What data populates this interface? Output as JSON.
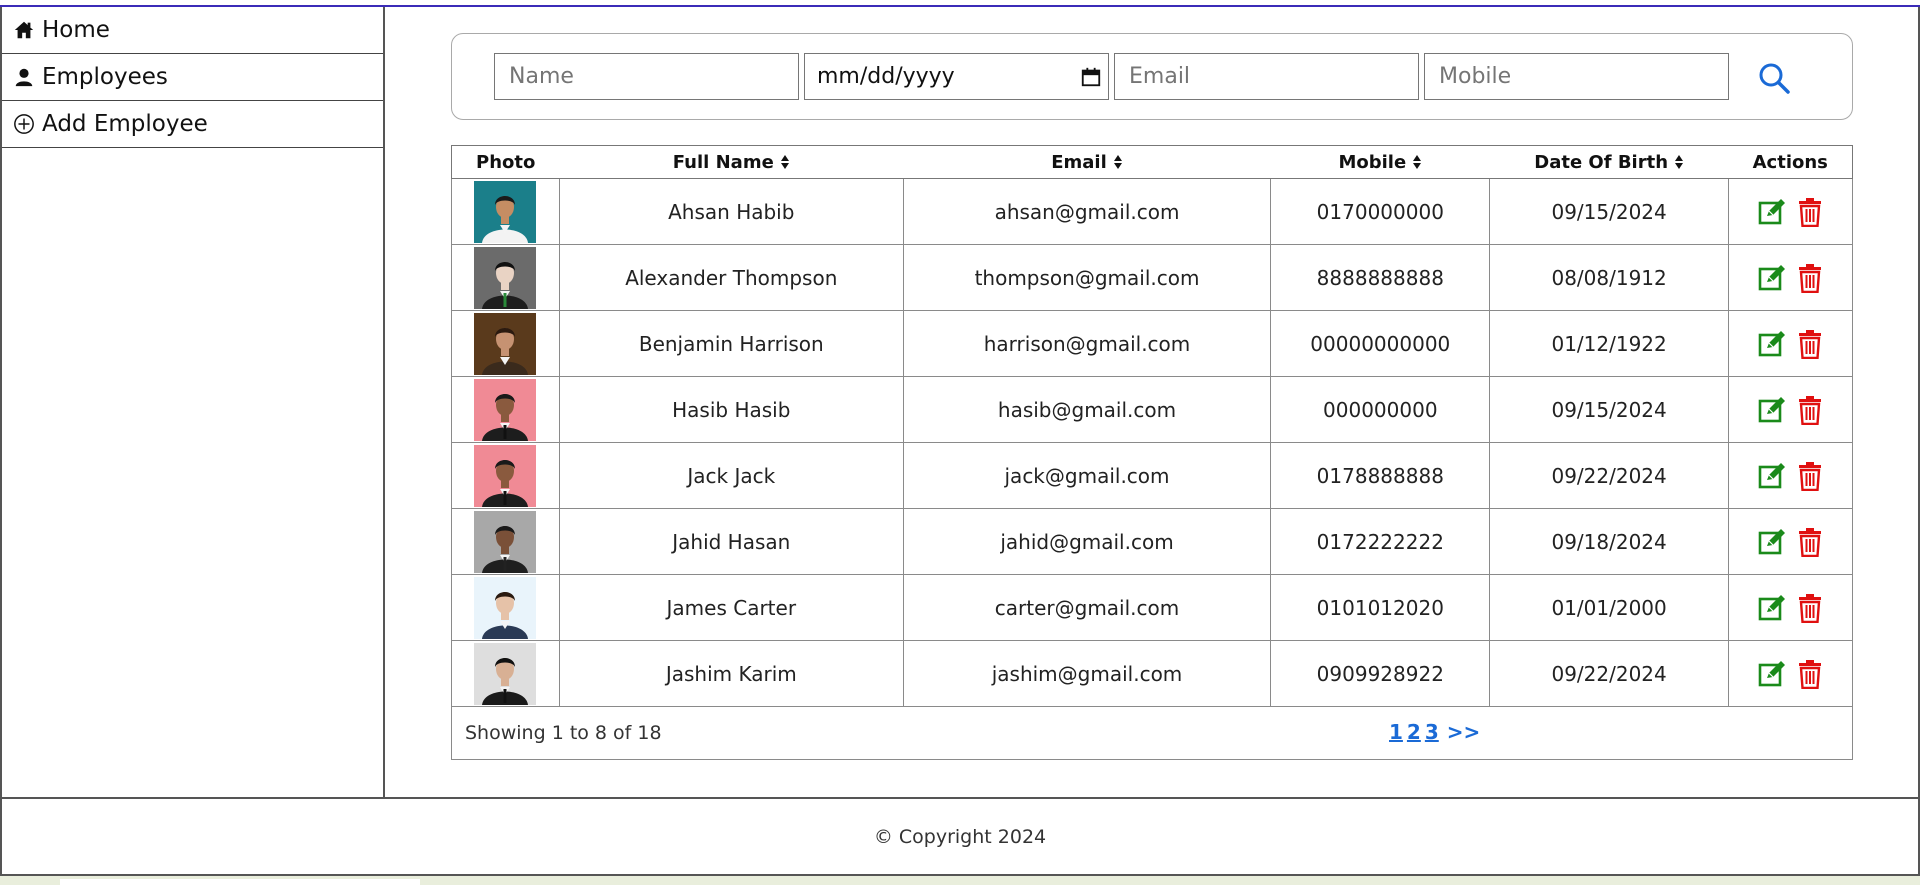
{
  "sidebar": {
    "items": [
      {
        "label": "Home",
        "icon": "home-icon"
      },
      {
        "label": "Employees",
        "icon": "person-icon"
      },
      {
        "label": "Add Employee",
        "icon": "plus-circle-icon"
      }
    ]
  },
  "search": {
    "name_placeholder": "Name",
    "date_placeholder": "mm/dd/yyyy",
    "email_placeholder": "Email",
    "mobile_placeholder": "Mobile",
    "search_icon": "search-icon"
  },
  "table": {
    "headers": {
      "photo": "Photo",
      "full_name": "Full Name",
      "email": "Email",
      "mobile": "Mobile",
      "dob": "Date Of Birth",
      "actions": "Actions"
    },
    "rows": [
      {
        "name": "Ahsan Habib",
        "email": "ahsan@gmail.com",
        "mobile": "0170000000",
        "dob": "09/15/2024"
      },
      {
        "name": "Alexander Thompson",
        "email": "thompson@gmail.com",
        "mobile": "8888888888",
        "dob": "08/08/1912"
      },
      {
        "name": "Benjamin Harrison",
        "email": "harrison@gmail.com",
        "mobile": "00000000000",
        "dob": "01/12/1922"
      },
      {
        "name": "Hasib Hasib",
        "email": "hasib@gmail.com",
        "mobile": "000000000",
        "dob": "09/15/2024"
      },
      {
        "name": "Jack Jack",
        "email": "jack@gmail.com",
        "mobile": "0178888888",
        "dob": "09/22/2024"
      },
      {
        "name": "Jahid Hasan",
        "email": "jahid@gmail.com",
        "mobile": "0172222222",
        "dob": "09/18/2024"
      },
      {
        "name": "James Carter",
        "email": "carter@gmail.com",
        "mobile": "0101012020",
        "dob": "01/01/2000"
      },
      {
        "name": "Jashim Karim",
        "email": "jashim@gmail.com",
        "mobile": "0909928922",
        "dob": "09/22/2024"
      }
    ]
  },
  "pagination": {
    "info": "Showing 1 to 8 of 18",
    "pages": [
      "1",
      "2",
      "3"
    ],
    "next": ">>"
  },
  "footer": {
    "copyright": "© Copyright 2024"
  },
  "colors": {
    "edit": "#1a8a1a",
    "delete": "#e01010",
    "link": "#1a6ad6",
    "search": "#1a6ad6"
  }
}
